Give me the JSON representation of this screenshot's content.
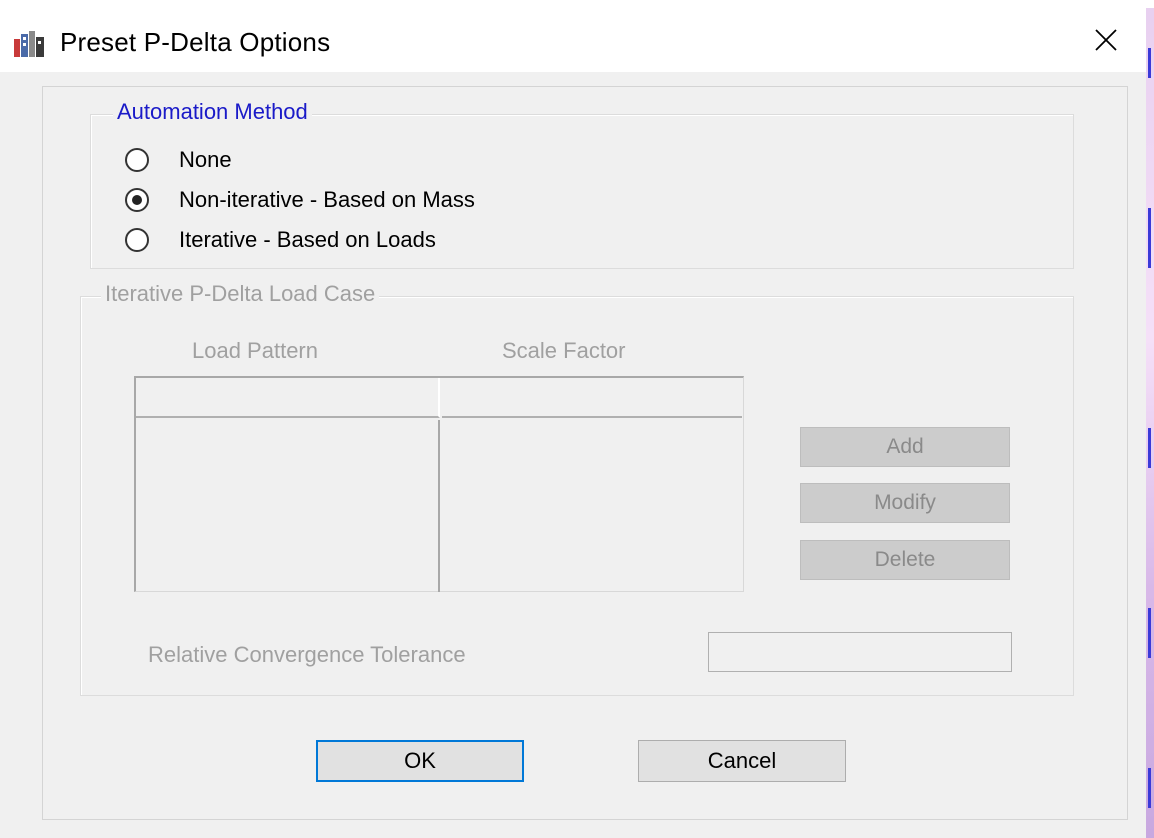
{
  "window": {
    "title": "Preset P-Delta Options"
  },
  "automation": {
    "legend": "Automation Method",
    "options": [
      {
        "label": "None",
        "checked": false
      },
      {
        "label": "Non-iterative - Based on Mass",
        "checked": true
      },
      {
        "label": "Iterative - Based on Loads",
        "checked": false
      }
    ]
  },
  "iterative": {
    "legend": "Iterative P-Delta Load Case",
    "columns": [
      "Load Pattern",
      "Scale Factor"
    ],
    "buttons": {
      "add": "Add",
      "modify": "Modify",
      "delete": "Delete"
    },
    "tolerance_label": "Relative Convergence Tolerance",
    "tolerance_value": ""
  },
  "footer": {
    "ok": "OK",
    "cancel": "Cancel"
  },
  "icons": {
    "app": "etabs-app-icon",
    "close": "close-icon"
  },
  "colors": {
    "accent": "#0078d7",
    "legend_active": "#1a1ac8",
    "disabled_text": "#a0a0a0"
  }
}
